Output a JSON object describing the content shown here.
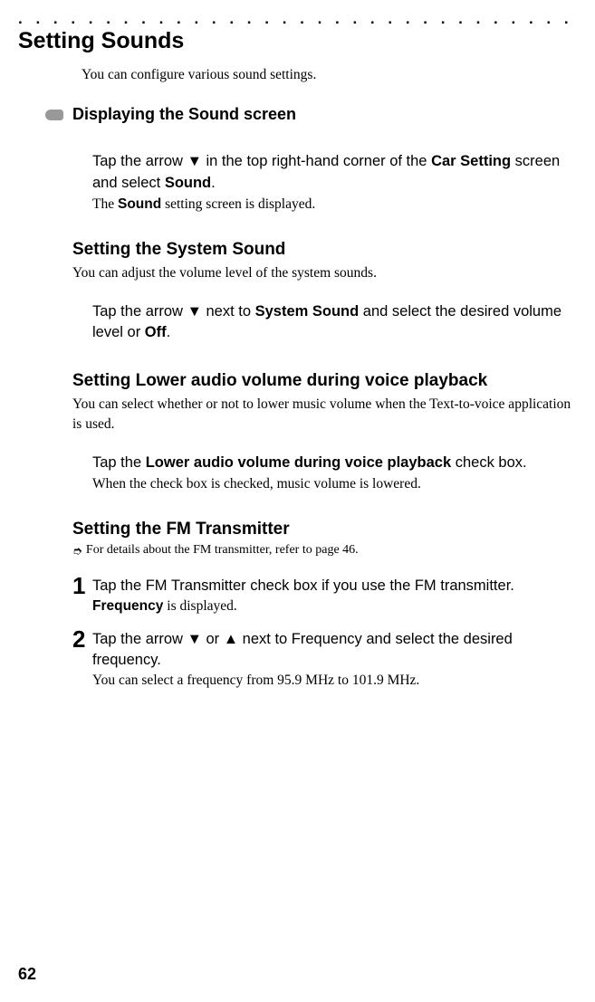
{
  "dots": ". . . . . . . . . . . . . . . . . . . . . . . . . . . . . . . . . . . . . . . . . . . . . . . . . . . . .",
  "main_title": "Setting Sounds",
  "intro": "You can configure various sound settings.",
  "sub_heading": "Displaying the Sound screen",
  "display_sound": {
    "p1a": "Tap the arrow ",
    "arrow_down": "▼",
    "p1b": " in the top right-hand corner of the ",
    "bold_car_setting": "Car Setting",
    "p1c": " screen and select ",
    "bold_sound": "Sound",
    "p1d": ".",
    "result_a": "The ",
    "result_bold": "Sound",
    "result_b": " setting screen is displayed."
  },
  "sys_sound": {
    "title": "Setting the System Sound",
    "desc": "You can adjust the volume level of the system sounds.",
    "p1a": "Tap the arrow ",
    "p1b": " next to ",
    "bold_system_sound": "System Sound",
    "p1c": " and select the desired volume level or ",
    "bold_off": "Off",
    "p1d": "."
  },
  "lower_audio": {
    "title": "Setting Lower audio volume during voice playback",
    "desc": "You can select whether or not to lower music volume when the Text-to-voice application is used.",
    "p1a": "Tap the ",
    "bold_label": "Lower audio volume during voice playback",
    "p1b": " check box.",
    "result": "When the check box is checked, music volume is lowered."
  },
  "fm": {
    "title": "Setting the FM Transmitter",
    "note_arrow": "➮",
    "note": "For details about the FM transmitter, refer to page 46.",
    "step1": {
      "num": "1",
      "p1a": "Tap the ",
      "bold_label": "FM Transmitter",
      "p1b": " check box if you use the FM transmitter.",
      "result_bold": "Frequency",
      "result_b": " is displayed."
    },
    "step2": {
      "num": "2",
      "p1a": "Tap the arrow ",
      "arrow_down": "▼",
      "p1b": " or ",
      "arrow_up": "▲",
      "p1c": " next to ",
      "bold_freq": "Frequency",
      "p1d": " and select the desired frequency.",
      "result": "You can select a frequency from 95.9 MHz to 101.9 MHz."
    }
  },
  "page_num": "62"
}
